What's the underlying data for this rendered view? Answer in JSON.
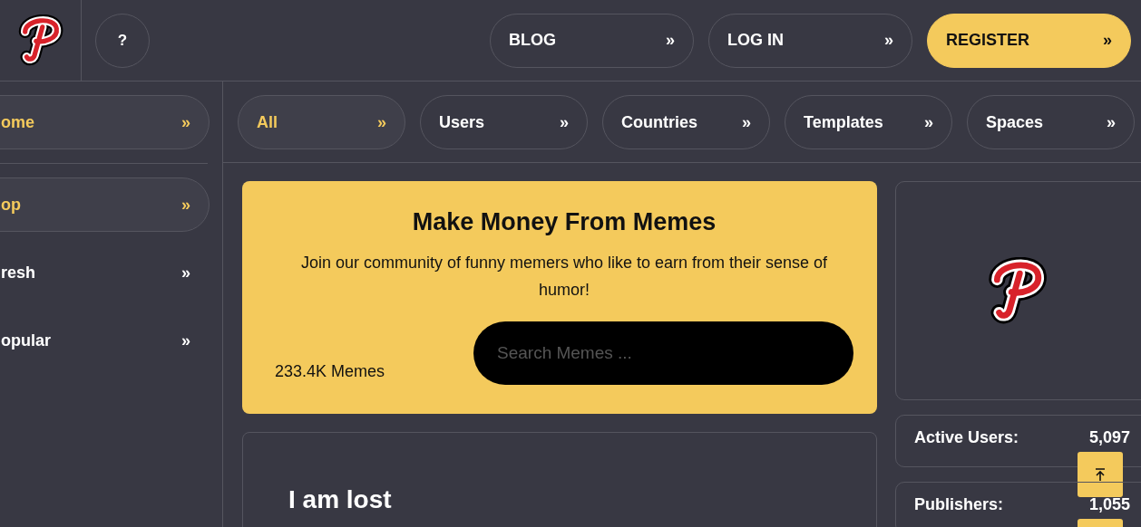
{
  "header": {
    "help": "?",
    "nav": [
      {
        "label": "BLOG",
        "primary": false
      },
      {
        "label": "LOG IN",
        "primary": false
      },
      {
        "label": "REGISTER",
        "primary": true
      }
    ],
    "chevron": "»"
  },
  "sidebar": {
    "groups": [
      {
        "items": [
          {
            "label": "ome",
            "selected": true
          }
        ]
      },
      {
        "items": [
          {
            "label": "op",
            "selected": true
          },
          {
            "label": "resh",
            "selected": false
          },
          {
            "label": "opular",
            "selected": false
          }
        ]
      }
    ]
  },
  "tabs": [
    {
      "label": "All",
      "selected": true
    },
    {
      "label": "Users",
      "selected": false
    },
    {
      "label": "Countries",
      "selected": false
    },
    {
      "label": "Templates",
      "selected": false
    },
    {
      "label": "Spaces",
      "selected": false
    }
  ],
  "promo": {
    "title": "Make Money From Memes",
    "text": "Join our community of funny memers who like to earn from their sense of humor!",
    "count": "233.4K Memes",
    "search": {
      "placeholder": "Search Memes ..."
    }
  },
  "lost_card": {
    "title": "I am lost"
  },
  "stats": [
    {
      "label": "Active Users:",
      "value": "5,097"
    },
    {
      "label": "Publishers:",
      "value": "1,055"
    }
  ]
}
